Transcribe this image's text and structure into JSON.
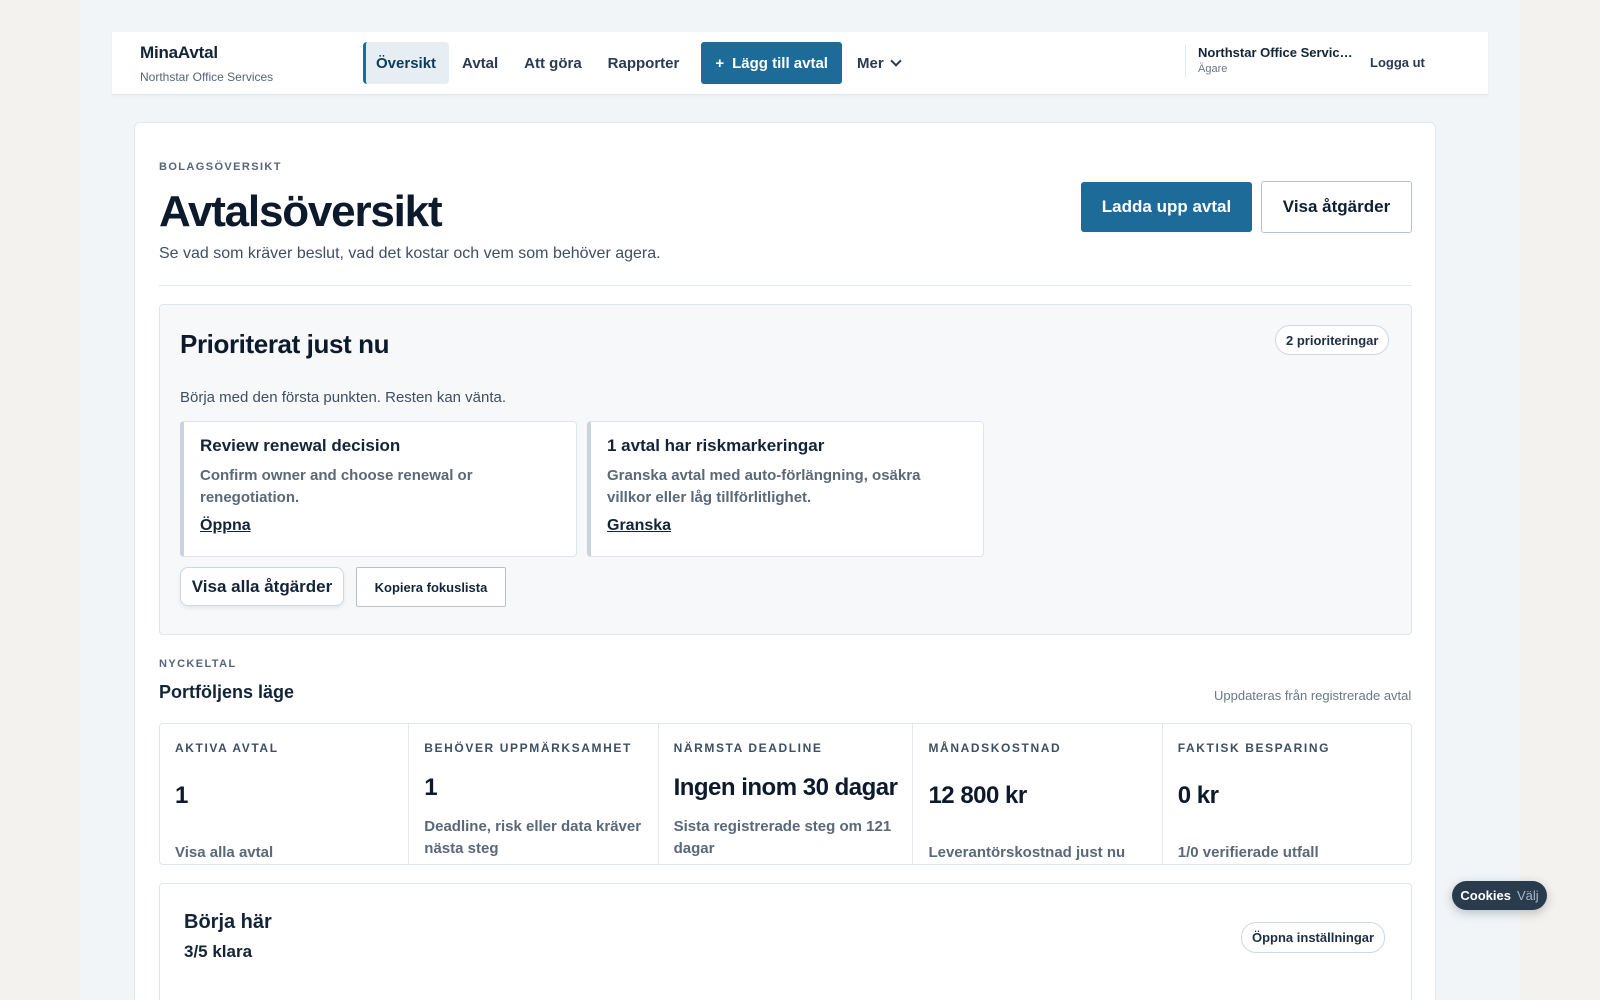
{
  "brand": {
    "name": "MinaAvtal",
    "company": "Northstar Office Services"
  },
  "nav": {
    "items": [
      {
        "label": "Översikt",
        "active": true
      },
      {
        "label": "Avtal",
        "active": false
      },
      {
        "label": "Att göra",
        "active": false
      },
      {
        "label": "Rapporter",
        "active": false
      }
    ],
    "add_label": "Lägg till avtal",
    "more_label": "Mer"
  },
  "account": {
    "name": "Northstar Office Services",
    "role": "Ägare",
    "logout_label": "Logga ut"
  },
  "page": {
    "eyebrow": "BOLAGSÖVERSIKT",
    "title": "Avtalsöversikt",
    "subtitle": "Se vad som kräver beslut, vad det kostar och vem som behöver agera.",
    "upload_label": "Ladda upp avtal",
    "actions_label": "Visa åtgärder"
  },
  "priority": {
    "title": "Prioriterat just nu",
    "count_label": "2 prioriteringar",
    "subtitle": "Börja med den första punkten. Resten kan vänta.",
    "cards": [
      {
        "title": "Review renewal decision",
        "description": "Confirm owner and choose renewal or renegotiation.",
        "link": "Öppna"
      },
      {
        "title": "1 avtal har riskmarkeringar",
        "description": "Granska avtal med auto-förlängning, osäkra villkor eller låg tillförlitlighet.",
        "link": "Granska"
      }
    ],
    "show_all_label": "Visa alla åtgärder",
    "copy_label": "Kopiera fokuslista"
  },
  "kpis": {
    "eyebrow": "NYCKELTAL",
    "title": "Portföljens läge",
    "note": "Uppdateras från registrerade avtal",
    "items": [
      {
        "label": "AKTIVA AVTAL",
        "value": "1",
        "description": "Visa alla avtal"
      },
      {
        "label": "BEHÖVER UPPMÄRKSAMHET",
        "value": "1",
        "description": "Deadline, risk eller data kräver nästa steg"
      },
      {
        "label": "NÄRMSTA DEADLINE",
        "value": "Ingen inom 30 dagar",
        "description": "Sista registrerade steg om 121 dagar"
      },
      {
        "label": "MÅNADSKOSTNAD",
        "value": "12 800 kr",
        "description": "Leverantörskostnad just nu"
      },
      {
        "label": "FAKTISK BESPARING",
        "value": "0 kr",
        "description": "1/0 verifierade utfall"
      }
    ]
  },
  "start": {
    "title": "Börja här",
    "progress": "3/5 klara",
    "settings_label": "Öppna inställningar"
  },
  "cookie": {
    "title": "Cookies",
    "choose": "Välj"
  },
  "colors": {
    "accent": "#1c6b98",
    "text": "#0f1f33",
    "muted": "#5a6878",
    "panel": "#f6f8fa"
  }
}
